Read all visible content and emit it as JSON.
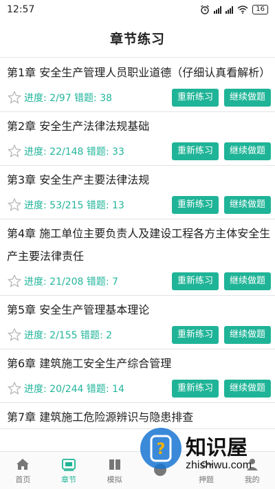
{
  "status_bar": {
    "time": "12:57",
    "battery": "16"
  },
  "header": {
    "title": "章节练习"
  },
  "chapters": [
    {
      "title": "第1章 安全生产管理人员职业道德（仔细认真看解析）",
      "progress": "进度: 2/97 错题: 38",
      "restart": "重新练习",
      "continue": "继续做题"
    },
    {
      "title": "第2章 安全生产法律法规基础",
      "progress": "进度: 22/148 错题: 33",
      "restart": "重新练习",
      "continue": "继续做题"
    },
    {
      "title": "第3章 安全生产主要法律法规",
      "progress": "进度: 53/215 错题: 13",
      "restart": "重新练习",
      "continue": "继续做题"
    },
    {
      "title": "第4章 施工单位主要负责人及建设工程各方主体安全生产主要法律责任",
      "progress": "进度: 21/208 错题: 7",
      "restart": "重新练习",
      "continue": "继续做题"
    },
    {
      "title": "第5章 安全生产管理基本理论",
      "progress": "进度: 2/155 错题: 2",
      "restart": "重新练习",
      "continue": "继续做题"
    },
    {
      "title": "第6章 建筑施工安全生产综合管理",
      "progress": "进度: 20/244 错题: 14",
      "restart": "重新练习",
      "continue": "继续做题"
    },
    {
      "title": "第7章 建筑施工危险源辨识与隐患排查",
      "progress": "",
      "restart": "",
      "continue": ""
    }
  ],
  "nav": [
    {
      "label": "首页",
      "icon": "home-icon"
    },
    {
      "label": "章节",
      "icon": "chapter-icon"
    },
    {
      "label": "模拟",
      "icon": "book-icon"
    },
    {
      "label": "",
      "icon": "question-icon"
    },
    {
      "label": "押题",
      "icon": "key-icon"
    },
    {
      "label": "我的",
      "icon": "user-icon"
    }
  ],
  "watermark": {
    "brand": "知识屋",
    "url": "zhishiwu.com"
  },
  "colors": {
    "accent": "#1fb497",
    "progress_text": "#22b59b",
    "nav_inactive": "#777777"
  }
}
